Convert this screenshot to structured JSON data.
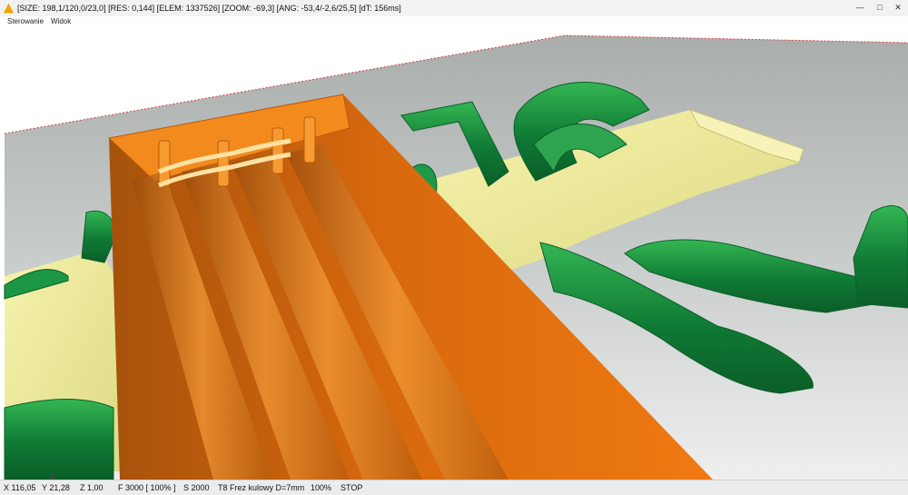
{
  "window": {
    "title": "[SIZE: 198,1/120,0/23,0] [RES: 0,144] [ELEM: 1337526] [ZOOM: -69,3] [ANG: -53,4/-2,6/25,5] [dT: 156ms]",
    "app_icon": "warning-triangle-icon",
    "controls": {
      "minimize": "minimize-icon",
      "maximize": "maximize-icon",
      "close": "close-icon"
    }
  },
  "menu": {
    "items": [
      "Sterowanie",
      "Widok"
    ]
  },
  "status": {
    "x": "X 116,05",
    "y": "Y 21,28",
    "z": "Z 1,00",
    "feed": "F 3000 [ 100% ]",
    "spindle": "S 2000",
    "tool": "T8 Frez kulowy D=7mm",
    "percent": "100%",
    "state": "STOP"
  },
  "scene": {
    "background": "#ffffff",
    "plane": "#b9bdbb",
    "pocket": "#e8e696",
    "orange": "#d66a0e",
    "orange_light": "#f08a22",
    "green": "#12803a",
    "green_light": "#2db14f"
  }
}
